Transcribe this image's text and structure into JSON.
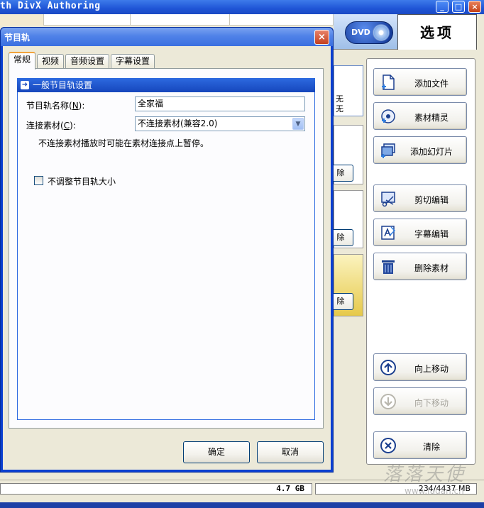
{
  "app": {
    "title": "th DivX Authoring",
    "window_buttons": {
      "minimize": "_",
      "maximize": "□",
      "close": "×"
    },
    "dvd_badge": "DVD",
    "options_tab": "选项"
  },
  "side_buttons": [
    {
      "label": "添加文件",
      "icon": "add-file-icon",
      "enabled": true
    },
    {
      "label": "素材精灵",
      "icon": "media-wizard-icon",
      "enabled": true
    },
    {
      "label": "添加幻灯片",
      "icon": "add-slideshow-icon",
      "enabled": true
    },
    {
      "label": "剪切编辑",
      "icon": "cut-edit-icon",
      "enabled": true
    },
    {
      "label": "字幕编辑",
      "icon": "subtitle-edit-icon",
      "enabled": true
    },
    {
      "label": "删除素材",
      "icon": "trash-icon",
      "enabled": true
    },
    {
      "label": "向上移动",
      "icon": "arrow-up-icon",
      "enabled": true
    },
    {
      "label": "向下移动",
      "icon": "arrow-down-icon",
      "enabled": false
    },
    {
      "label": "清除",
      "icon": "clear-icon",
      "enabled": true
    }
  ],
  "middle_list": {
    "first_item_text": "无\n无",
    "item_button_label": "除"
  },
  "status": {
    "disc_capacity": "4.7 GB",
    "usage": "234/4437 MB"
  },
  "dialog": {
    "title": "节目轨",
    "close_symbol": "×",
    "tabs": [
      {
        "label": "常规",
        "active": true
      },
      {
        "label": "视频",
        "active": false
      },
      {
        "label": "音频设置",
        "active": false
      },
      {
        "label": "字幕设置",
        "active": false
      }
    ],
    "group_title": "一般节目轨设置",
    "group_arrow": "➜",
    "name_label": "节目轨名称(",
    "name_hotkey": "N",
    "name_label_end": "):",
    "name_value": "全家福",
    "connect_label": "连接素材(",
    "connect_hotkey": "C",
    "connect_label_end": "):",
    "connect_value": "不连接素材(兼容2.0)",
    "hint": "不连接素材播放时可能在素材连接点上暂停。",
    "checkbox_label": "不调整节目轨大小",
    "checkbox_checked": false,
    "ok_label": "确定",
    "cancel_label": "取消"
  },
  "watermark": {
    "text": "落落天使",
    "url": "www.ludan.cn"
  },
  "colors": {
    "title_bar": "#1f55d6",
    "dialog_frame": "#0b3fd0",
    "group_header": "#1646bc",
    "active_tab_accent": "#f1a33b",
    "panel_bg": "#ece9d8"
  }
}
